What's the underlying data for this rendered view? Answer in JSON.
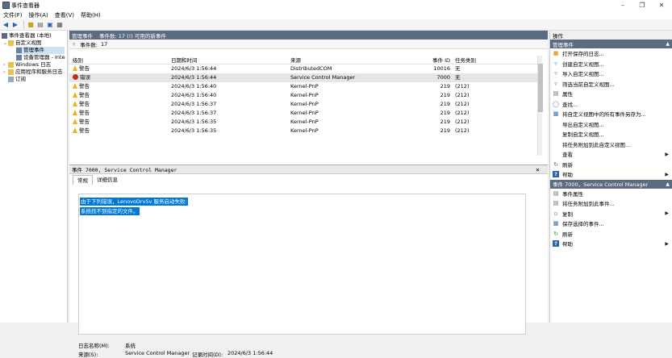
{
  "window": {
    "title": "事件查看器"
  },
  "menu": [
    "文件(F)",
    "操作(A)",
    "查看(V)",
    "帮助(H)"
  ],
  "tree": {
    "root": "事件查看器 (本地)",
    "custom": "自定义视图",
    "admin": "管理事件",
    "devmgr": "设备管理器 - Inte",
    "winlogs": "Windows 日志",
    "appsvc": "应用程序和服务日志",
    "subs": "订阅"
  },
  "center": {
    "title": "管理事件",
    "subtitle": "事件数: 17 (!) 可用的新事件",
    "filter_label": "事件数:",
    "filter_count": "17",
    "columns": [
      "级别",
      "日期和时间",
      "来源",
      "事件 ID",
      "任务类别"
    ],
    "rows": [
      {
        "level": "警告",
        "type": "warn",
        "time": "2024/6/3 1:56:44",
        "source": "DistributedCOM",
        "id": "10016",
        "task": "无"
      },
      {
        "level": "错误",
        "type": "err",
        "time": "2024/6/3 1:56:44",
        "source": "Service Control Manager",
        "id": "7000",
        "task": "无"
      },
      {
        "level": "警告",
        "type": "warn",
        "time": "2024/6/3 1:56:40",
        "source": "Kernel-PnP",
        "id": "219",
        "task": "(212)"
      },
      {
        "level": "警告",
        "type": "warn",
        "time": "2024/6/3 1:56:40",
        "source": "Kernel-PnP",
        "id": "219",
        "task": "(212)"
      },
      {
        "level": "警告",
        "type": "warn",
        "time": "2024/6/3 1:56:37",
        "source": "Kernel-PnP",
        "id": "219",
        "task": "(212)"
      },
      {
        "level": "警告",
        "type": "warn",
        "time": "2024/6/3 1:56:37",
        "source": "Kernel-PnP",
        "id": "219",
        "task": "(212)"
      },
      {
        "level": "警告",
        "type": "warn",
        "time": "2024/6/3 1:56:35",
        "source": "Kernel-PnP",
        "id": "219",
        "task": "(212)"
      },
      {
        "level": "警告",
        "type": "warn",
        "time": "2024/6/3 1:56:35",
        "source": "Kernel-PnP",
        "id": "219",
        "task": "(212)"
      }
    ]
  },
  "detail": {
    "header": "事件 7000, Service Control Manager",
    "tabs": [
      "常规",
      "详细信息"
    ],
    "message_line1": "由于下列错误，LenovoDrvSv 服务启动失败:",
    "message_line2": "系统找不到指定的文件。",
    "logname_label": "日志名称(M):",
    "logname_value": "系统",
    "source_label": "来源(S):",
    "source_value": "Service Control Manager",
    "logged_label": "记录时间(D):",
    "logged_value": "2024/6/3 1:56:44"
  },
  "actions": {
    "title": "操作",
    "section1": "管理事件",
    "items1": [
      {
        "label": "打开保存的日志...",
        "icon": "open-log-icon"
      },
      {
        "label": "创建自定义视图...",
        "icon": "filter-create-icon"
      },
      {
        "label": "导入自定义视图...",
        "icon": "import-icon"
      },
      {
        "label": "筛选当前自定义视图...",
        "icon": "filter-icon"
      },
      {
        "label": "属性",
        "icon": "properties-icon"
      },
      {
        "label": "查找...",
        "icon": "find-icon"
      },
      {
        "label": "将自定义视图中的所有事件另存为...",
        "icon": "save-icon"
      },
      {
        "label": "导出自定义视图...",
        "icon": ""
      },
      {
        "label": "复制自定义视图...",
        "icon": ""
      },
      {
        "label": "将任务附加到此自定义视图...",
        "icon": ""
      },
      {
        "label": "查看",
        "icon": "",
        "arrow": true
      },
      {
        "label": "刷新",
        "icon": "refresh-icon"
      },
      {
        "label": "帮助",
        "icon": "help-icon",
        "arrow": true
      }
    ],
    "section2": "事件 7000，Service Control Manager",
    "items2": [
      {
        "label": "事件属性",
        "icon": "event-properties-icon"
      },
      {
        "label": "将任务附加到此事件...",
        "icon": "attach-task-icon"
      },
      {
        "label": "复制",
        "icon": "copy-icon",
        "arrow": true
      },
      {
        "label": "保存选择的事件...",
        "icon": "save-icon"
      },
      {
        "label": "刷新",
        "icon": "refresh-icon"
      },
      {
        "label": "帮助",
        "icon": "help-icon",
        "arrow": true
      }
    ]
  }
}
